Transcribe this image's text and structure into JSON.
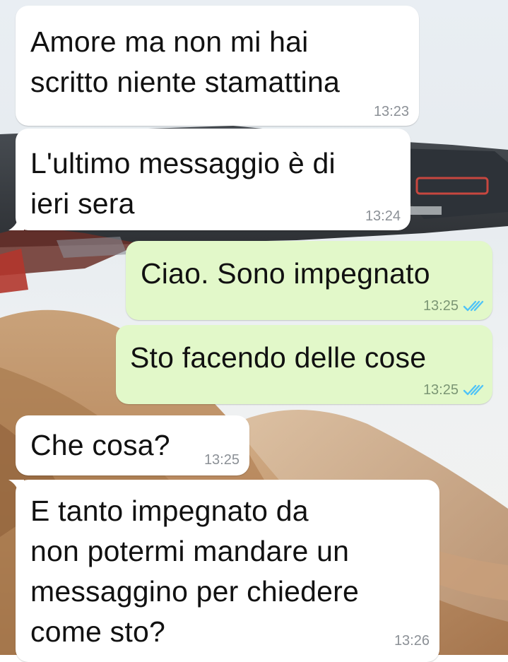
{
  "colors": {
    "incoming_bubble": "#ffffff",
    "outgoing_bubble": "#e2f8c9",
    "timestamp": "#8b9096",
    "read_ticks": "#4fc3f7"
  },
  "messages": [
    {
      "direction": "in",
      "text": "Amore ma non mi hai\nscritto niente stamattina",
      "time": "13:23"
    },
    {
      "direction": "in",
      "text": "L'ultimo messaggio è di\nieri sera",
      "time": "13:24"
    },
    {
      "direction": "out",
      "text": "Ciao. Sono impegnato",
      "time": "13:25",
      "status_icon": "double-check-icon"
    },
    {
      "direction": "out",
      "text": "Sto facendo delle cose",
      "time": "13:25",
      "status_icon": "double-check-icon"
    },
    {
      "direction": "in",
      "text": "Che cosa?",
      "time": "13:25"
    },
    {
      "direction": "in",
      "text": "E tanto impegnato da\nnon potermi mandare un\nmessaggino per chiedere\ncome sto?",
      "time": "13:26"
    }
  ]
}
